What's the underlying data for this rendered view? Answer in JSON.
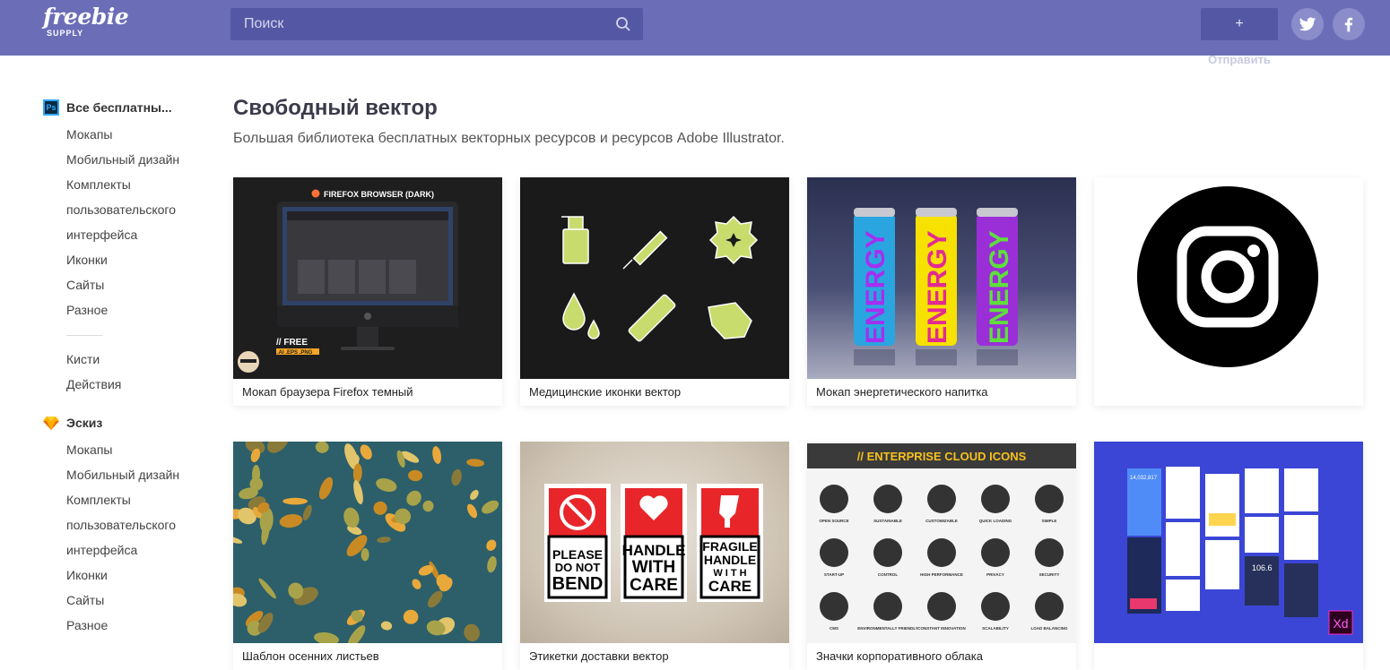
{
  "header": {
    "logo_line1": "freebie",
    "logo_line2": "SUPPLY",
    "search_placeholder": "Поиск",
    "submit_icon": "+",
    "submit_label": "Отправить",
    "social": [
      "twitter-icon",
      "facebook-icon"
    ]
  },
  "sidebar": {
    "groups": [
      {
        "icon": "photoshop-icon",
        "title": "Все бесплатны...",
        "items": [
          "Мокапы",
          "Мобильный дизайн",
          "Комплекты",
          "пользовательского",
          "интерфейса",
          "Иконки",
          "Сайты",
          "Разное"
        ],
        "extra": [
          "Кисти",
          "Действия"
        ]
      },
      {
        "icon": "sketch-icon",
        "title": "Эскиз",
        "items": [
          "Мокапы",
          "Мобильный дизайн",
          "Комплекты",
          "пользовательского",
          "интерфейса",
          "Иконки",
          "Сайты",
          "Разное"
        ]
      }
    ]
  },
  "main": {
    "title": "Свободный вектор",
    "subtitle": "Большая библиотека бесплатных векторных ресурсов и ресурсов Adobe Illustrator.",
    "cards": [
      {
        "caption": "Мокап браузера Firefox темный",
        "thumb_text": "FIREFOX BROWSER (DARK)",
        "badge": "// FREE",
        "formats": ".AI .EPS .PNG"
      },
      {
        "caption": "Медицинские иконки вектор"
      },
      {
        "caption": "Мокап энергетического напитка",
        "thumb_text": "ENERGY"
      },
      {
        "caption": ""
      },
      {
        "caption": "Шаблон осенних листьев"
      },
      {
        "caption": "Этикетки доставки вектор",
        "labels": [
          "PLEASE DO NOT BEND",
          "HANDLE WITH CARE",
          "FRAGILE HANDLE WITH CARE"
        ]
      },
      {
        "caption": "Значки корпоративного облака",
        "thumb_text": "// ENTERPRISE CLOUD ICONS",
        "icon_labels": [
          "OPEN SOURCE",
          "SUSTAINABLE",
          "CUSTOMIZABLE",
          "QUICK LOADING",
          "SIMPLE",
          "START-UP",
          "CONTROL",
          "HIGH PERFORMANCE",
          "PRIVACY",
          "SECURITY",
          "CMS",
          "ENVIRONMENTALLY FRIENDLY",
          "CONSTANT INNOVATION",
          "SCALABILITY",
          "LOAD BALANCING"
        ]
      },
      {
        "caption": "",
        "badge": "Xd",
        "stats": [
          "14,032,817",
          "106.6"
        ]
      }
    ]
  },
  "colors": {
    "header": "#6b6eb7",
    "search": "#5458a4",
    "accent_green": "#c8dc6e"
  }
}
